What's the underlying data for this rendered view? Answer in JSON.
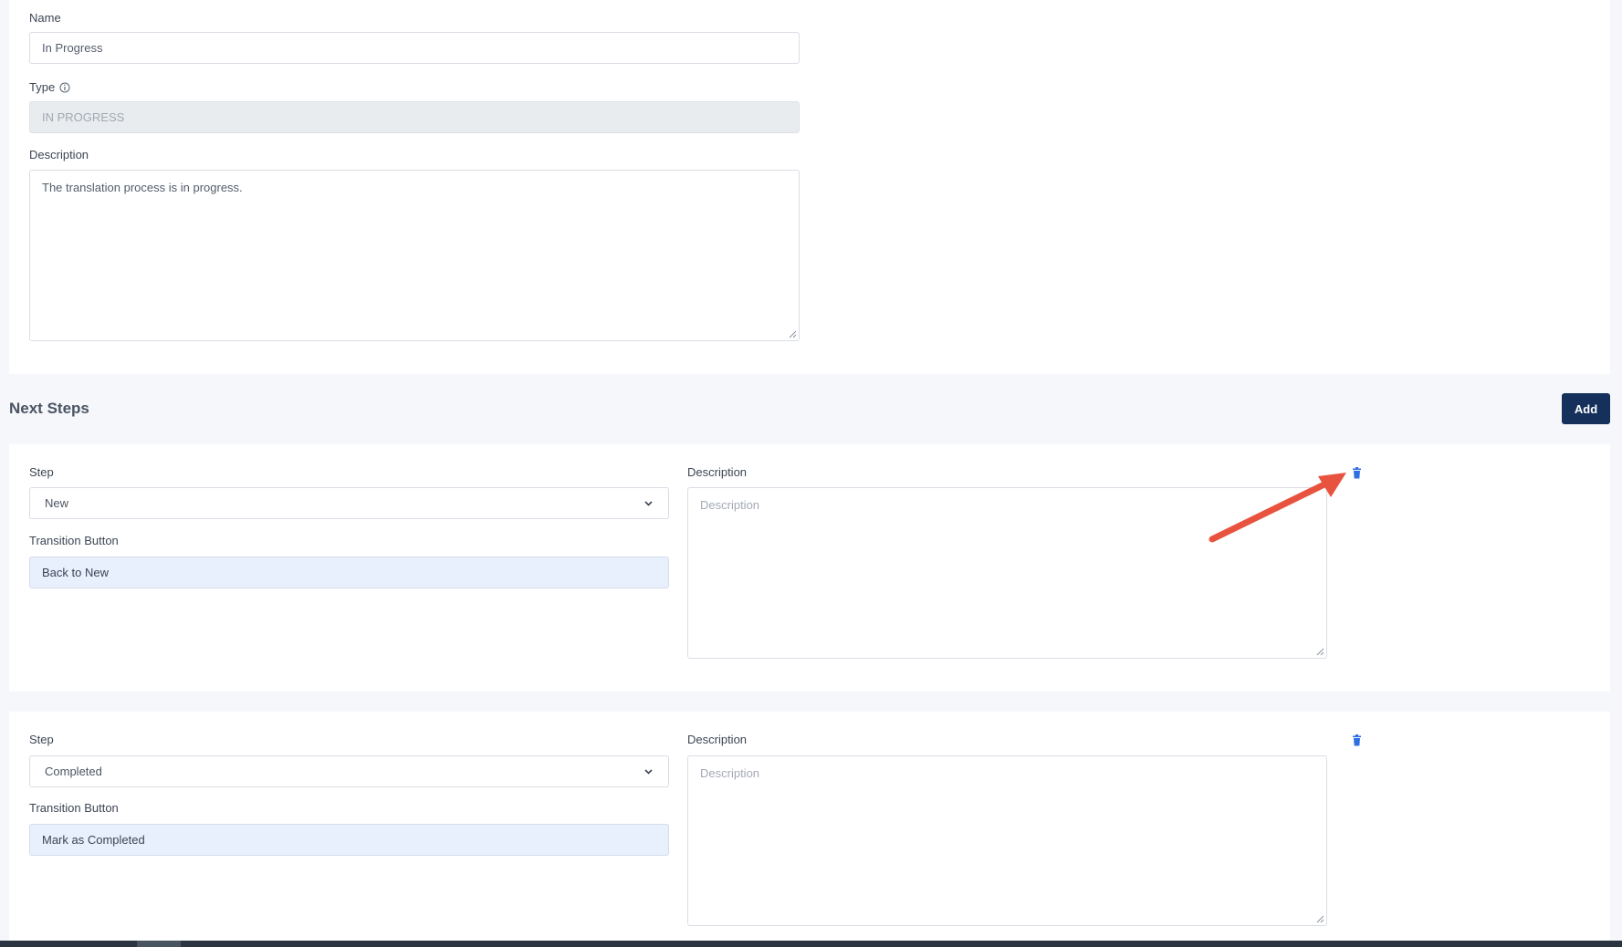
{
  "status_form": {
    "name_label": "Name",
    "name_value": "In Progress",
    "type_label": "Type",
    "type_value": "IN PROGRESS",
    "description_label": "Description",
    "description_value": "The translation process is in progress."
  },
  "next_steps": {
    "title": "Next Steps",
    "add_label": "Add",
    "steps": [
      {
        "step_label": "Step",
        "step_value": "New",
        "transition_label": "Transition Button",
        "transition_value": "Back to New",
        "description_label": "Description",
        "description_placeholder": "Description"
      },
      {
        "step_label": "Step",
        "step_value": "Completed",
        "transition_label": "Transition Button",
        "transition_value": "Mark as Completed",
        "description_label": "Description",
        "description_placeholder": "Description"
      }
    ]
  },
  "colors": {
    "primary_button": "#14305b",
    "delete_icon": "#2f6fe4",
    "annotation_arrow": "#e8533f",
    "autofill_bg": "#e8f0fe"
  },
  "icons": {
    "type_info": "info-circle-icon",
    "delete": "trash-icon",
    "select_toggle": "chevron-down-icon"
  }
}
